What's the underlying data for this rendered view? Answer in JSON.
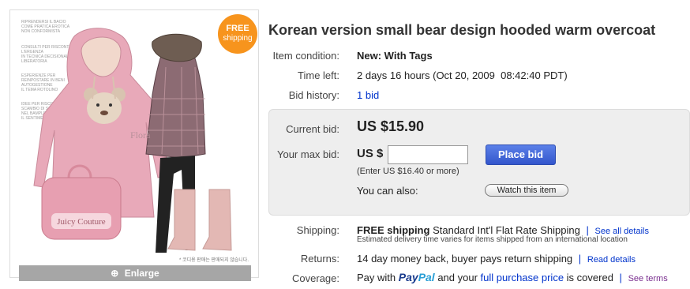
{
  "badge": {
    "line1": "FREE",
    "line2": "shipping"
  },
  "image": {
    "brand_text": "Flora",
    "bag_text": "Juicy Couture",
    "watermark_lines": [
      "RIPRENDERSI IL BACIO",
      "COME PRATICA EROTICA",
      "NON CONFORMISTA",
      "CONSULTI PER RISCONTRI",
      "L'ERGENZA",
      "IN TECNICA DECISIONALE",
      "LIBERATORIA",
      "ESPERIENZE PER",
      "REINPOSTARE IN BENI",
      "AUTOGESTIONE",
      "IL TEMA ROTOLINO",
      "IDEE PER RISCOSE",
      "SCAMBIO DI SOPRA",
      "NEL BAMPLESSO",
      "IL SENTIMENTO"
    ],
    "footnote": "* 코디용 판매는 판매되지 않습니다."
  },
  "enlarge": {
    "label": "Enlarge",
    "icon": "magnifier-plus-icon"
  },
  "title": "Korean version small bear design hooded warm overcoat",
  "item_condition": {
    "label": "Item condition:",
    "value": "New: With Tags"
  },
  "time_left": {
    "label": "Time left:",
    "value": "2 days 16 hours (Oct 20, 2009  08:42:40 PDT)"
  },
  "bid_history": {
    "label": "Bid history:",
    "value": "1 bid"
  },
  "bid_box": {
    "current_bid_label": "Current bid:",
    "current_bid_value": "US $15.90",
    "max_bid_label": "Your max bid:",
    "currency_prefix": "US $",
    "max_bid_input_value": "",
    "hint": "(Enter US $16.40 or more)",
    "place_bid_label": "Place bid",
    "also_label": "You can also:",
    "watch_label": "Watch this item"
  },
  "shipping": {
    "label": "Shipping:",
    "free": "FREE shipping",
    "method": "Standard Int'l Flat Rate Shipping",
    "separator": "|",
    "link": "See all details",
    "sub": "Estimated delivery time varies for items shipped from an international location"
  },
  "returns": {
    "label": "Returns:",
    "text": "14 day money back, buyer pays return shipping",
    "separator": "|",
    "link": "Read details"
  },
  "coverage": {
    "label": "Coverage:",
    "pay_with": "Pay with",
    "paypal_pay": "Pay",
    "paypal_pal": "Pal",
    "and_your": "and your",
    "link": "full purchase price",
    "covered": "is covered",
    "separator": "|",
    "terms": "See terms"
  },
  "colors": {
    "accent": "#3356cc",
    "link": "#0033cc",
    "badge": "#f7941d",
    "bid_box": "#eeeeee"
  }
}
